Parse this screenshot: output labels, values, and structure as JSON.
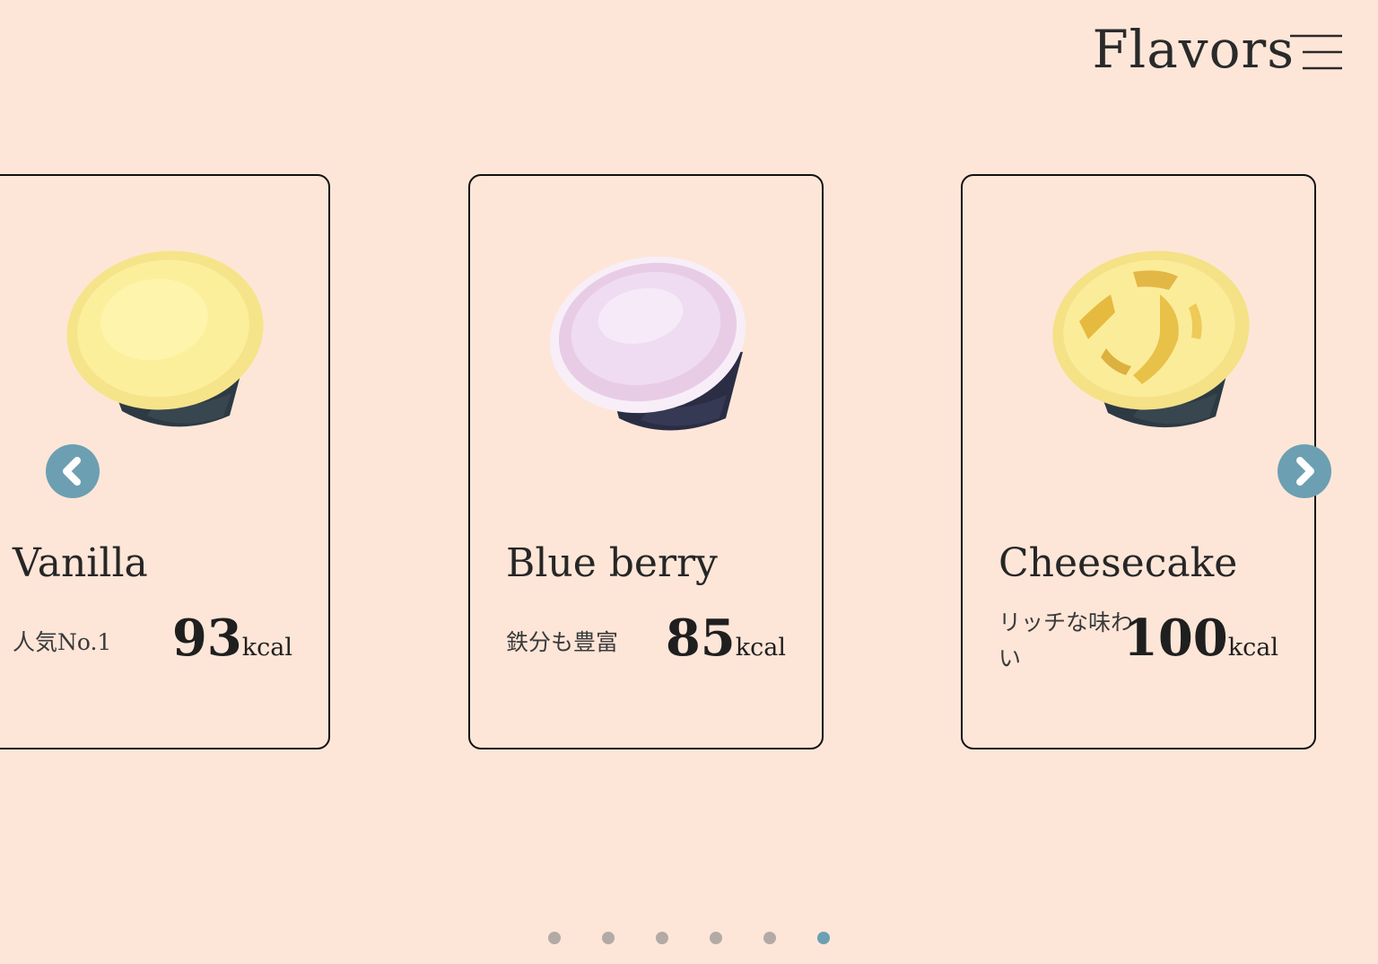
{
  "header": {
    "title": "Flavors",
    "menu_icon": "hamburger-menu-icon"
  },
  "carousel": {
    "prev_icon": "chevron-left-icon",
    "next_icon": "chevron-right-icon",
    "cards": [
      {
        "name": "Vanilla",
        "note": "人気No.1",
        "kcal": "93",
        "unit": "kcal",
        "cup_color": "#fcef9c",
        "image": "vanilla-cup-image"
      },
      {
        "name": "Blue berry",
        "note": "鉄分も豊富",
        "kcal": "85",
        "unit": "kcal",
        "cup_color": "#eed6ec",
        "image": "blueberry-cup-image"
      },
      {
        "name": "Cheesecake",
        "note": "リッチな味わい",
        "kcal": "100",
        "unit": "kcal",
        "cup_color": "#fbec9a",
        "image": "cheesecake-cup-image"
      }
    ],
    "pagination": {
      "total": 6,
      "active_index": 5
    }
  },
  "colors": {
    "background": "#fde6d8",
    "accent": "#6c9fb2",
    "dot_inactive": "#b3aaa5",
    "card_border": "#111111"
  }
}
